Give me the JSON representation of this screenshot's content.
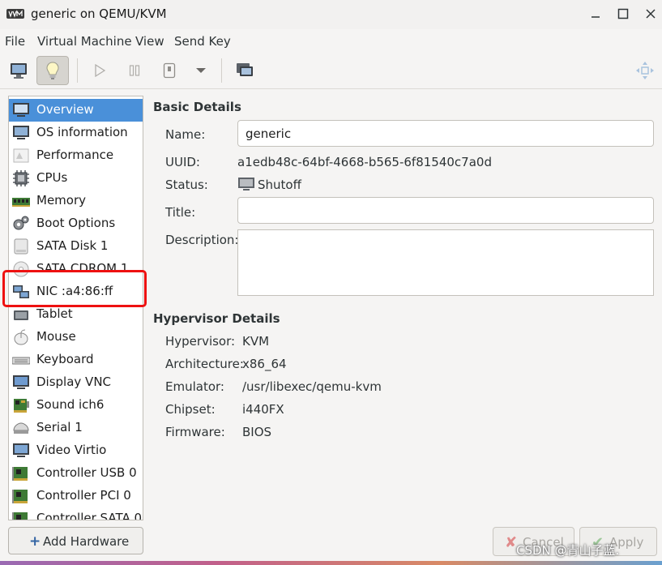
{
  "window": {
    "title": "generic on QEMU/KVM"
  },
  "menu": [
    "File",
    "Virtual Machine",
    "View",
    "Send Key"
  ],
  "sidebar": {
    "items": [
      {
        "label": "Overview",
        "icon": "monitor-icon"
      },
      {
        "label": "OS information",
        "icon": "monitor-icon"
      },
      {
        "label": "Performance",
        "icon": "performance-icon"
      },
      {
        "label": "CPUs",
        "icon": "cpu-icon"
      },
      {
        "label": "Memory",
        "icon": "memory-icon"
      },
      {
        "label": "Boot Options",
        "icon": "gears-icon"
      },
      {
        "label": "SATA Disk 1",
        "icon": "disk-icon"
      },
      {
        "label": "SATA CDROM 1",
        "icon": "cdrom-icon"
      },
      {
        "label": "NIC :a4:86:ff",
        "icon": "network-icon"
      },
      {
        "label": "Tablet",
        "icon": "tablet-icon"
      },
      {
        "label": "Mouse",
        "icon": "mouse-icon"
      },
      {
        "label": "Keyboard",
        "icon": "keyboard-icon"
      },
      {
        "label": "Display VNC",
        "icon": "monitor-icon"
      },
      {
        "label": "Sound ich6",
        "icon": "sound-card-icon"
      },
      {
        "label": "Serial 1",
        "icon": "serial-icon"
      },
      {
        "label": "Video Virtio",
        "icon": "monitor-icon"
      },
      {
        "label": "Controller USB 0",
        "icon": "controller-card-icon"
      },
      {
        "label": "Controller PCI 0",
        "icon": "controller-card-icon"
      },
      {
        "label": "Controller SATA 0",
        "icon": "controller-card-icon"
      }
    ],
    "selected": "Overview"
  },
  "add_hardware": {
    "label": "Add Hardware"
  },
  "basic": {
    "title": "Basic Details",
    "name_label": "Name:",
    "name_value": "generic",
    "uuid_label": "UUID:",
    "uuid_value": "a1edb48c-64bf-4668-b565-6f81540c7a0d",
    "status_label": "Status:",
    "status_value": "Shutoff",
    "title_label": "Title:",
    "title_value": "",
    "description_label": "Description:",
    "description_value": ""
  },
  "hypervisor": {
    "title": "Hypervisor Details",
    "hypervisor_label": "Hypervisor:",
    "hypervisor_value": "KVM",
    "arch_label": "Architecture:",
    "arch_value": "x86_64",
    "emulator_label": "Emulator:",
    "emulator_value": "/usr/libexec/qemu-kvm",
    "chipset_label": "Chipset:",
    "chipset_value": "i440FX",
    "firmware_label": "Firmware:",
    "firmware_value": "BIOS"
  },
  "footer": {
    "cancel_label": "Cancel",
    "apply_label": "Apply"
  },
  "watermark": "CSDN @青山子蓝.",
  "colors": {
    "selection": "#4a90d9",
    "highlight": "#ee1111"
  }
}
